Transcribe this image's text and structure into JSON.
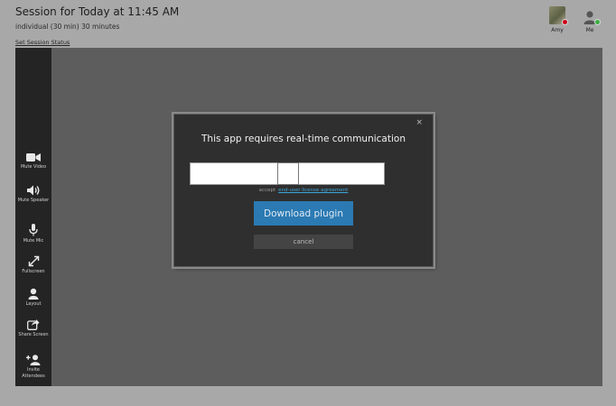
{
  "header": {
    "title": "Session for Today at 11:45 AM",
    "subtitle": "individual (30 min) 30 minutes",
    "status_link": "Set Session Status"
  },
  "participants": [
    {
      "name": "Amy",
      "status_color": "#d0021b",
      "avatar": "photo"
    },
    {
      "name": "Me",
      "status_color": "#3cb043",
      "avatar": "user-icon"
    }
  ],
  "toolbar": {
    "items": [
      {
        "label": "Mute Video",
        "icon": "video-camera-icon"
      },
      {
        "label": "Mute Speaker",
        "icon": "speaker-icon"
      },
      {
        "label": "Mute Mic",
        "icon": "microphone-icon"
      },
      {
        "label": "Fullscreen",
        "icon": "expand-icon"
      },
      {
        "label": "Layout",
        "icon": "user-icon"
      },
      {
        "label": "Share Screen",
        "icon": "share-icon"
      },
      {
        "label": "Invite Attendees",
        "icon": "add-user-icon"
      }
    ]
  },
  "modal": {
    "title": "This app requires real-time communication",
    "close_glyph": "×",
    "accept_text": "accept",
    "eula_link": "end-user license agreement",
    "download_label": "Download plugin",
    "cancel_label": "cancel"
  },
  "colors": {
    "page_bg": "#a8a8a8",
    "stage_bg": "#5d5d5d",
    "sidebar_bg": "#242424",
    "modal_bg": "#2f2f2f",
    "primary_button": "#2b7ab3",
    "link": "#3aa6d8"
  }
}
